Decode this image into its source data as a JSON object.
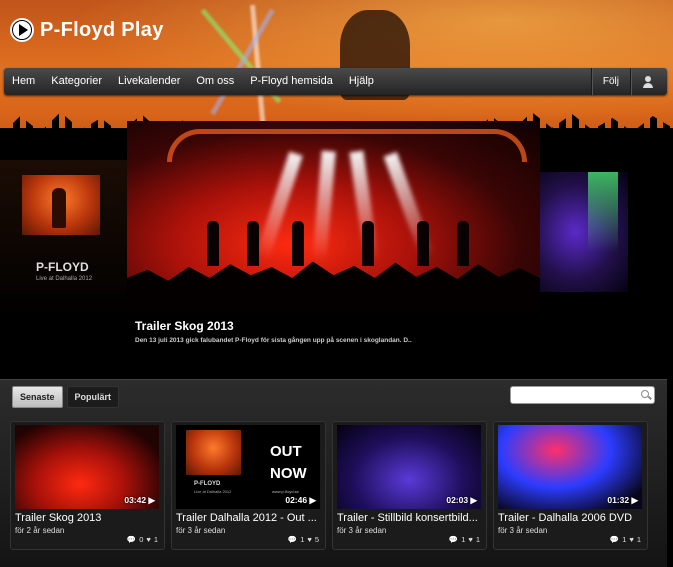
{
  "brand": {
    "name": "P-Floyd Play"
  },
  "nav": {
    "items": [
      "Hem",
      "Kategorier",
      "Livekalender",
      "Om oss",
      "P-Floyd hemsida",
      "Hjälp"
    ],
    "follow": "Följ"
  },
  "carousel": {
    "left_poster": {
      "title": "P-FLOYD",
      "subtitle": "Live at Dalhalla 2012"
    },
    "featured": {
      "title": "Trailer Skog 2013",
      "description": "Den 13 juli 2013 gick falubandet P-Floyd för sista gången upp på scenen i skoglandan. D.."
    }
  },
  "tabs": {
    "latest": "Senaste",
    "popular": "Populärt"
  },
  "search": {
    "placeholder": "",
    "value": ""
  },
  "videos": [
    {
      "title": "Trailer Skog 2013",
      "age": "för 2 år sedan",
      "duration": "03:42",
      "comments": "0",
      "likes": "1"
    },
    {
      "title": "Trailer Dalhalla 2012 - Out ...",
      "age": "för 3 år sedan",
      "duration": "02:46",
      "comments": "1",
      "likes": "5",
      "thumb_text_1": "OUT",
      "thumb_text_2": "NOW",
      "thumb_caption": "P-FLOYD",
      "thumb_sub": "Live at Dalhalla 2012",
      "thumb_url": "www.p-floyd.se"
    },
    {
      "title": "Trailer - Stillbild konsertbild...",
      "age": "för 3 år sedan",
      "duration": "02:03",
      "comments": "1",
      "likes": "1"
    },
    {
      "title": "Trailer - Dalhalla 2006 DVD",
      "age": "för 3 år sedan",
      "duration": "01:32",
      "comments": "1",
      "likes": "1"
    }
  ]
}
